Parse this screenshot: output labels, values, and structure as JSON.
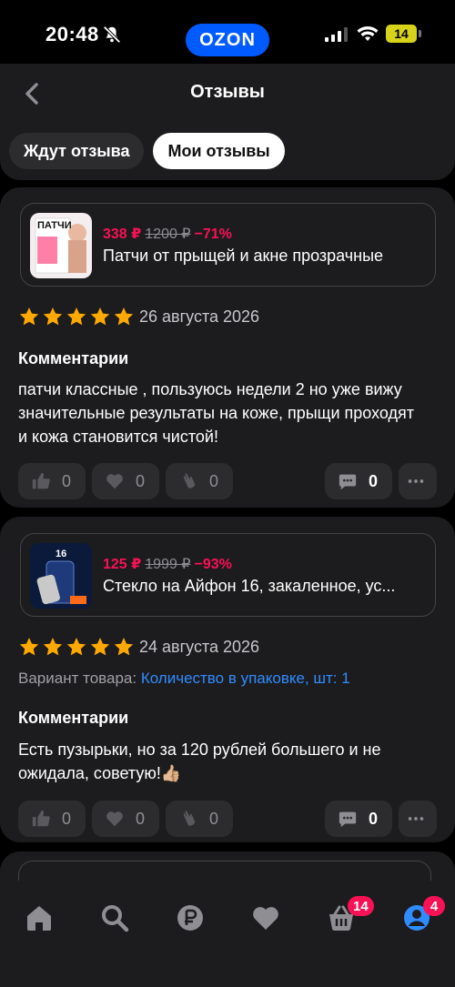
{
  "status": {
    "time": "20:48",
    "battery": "14"
  },
  "brand": "OZON",
  "header": {
    "title": "Отзывы"
  },
  "tabs": [
    {
      "label": "Ждут отзыва"
    },
    {
      "label": "Мои отзывы"
    }
  ],
  "reviews": [
    {
      "price": "338 ₽",
      "old_price": "1200 ₽",
      "discount": "−71%",
      "product_name": "Патчи от прыщей и акне прозрачные",
      "thumb_text": "ПАТЧИ",
      "rating": 5,
      "date": "26 августа 2026",
      "comment_title": "Комментарии",
      "comment": "патчи классные , пользуюсь недели 2 но уже вижу значительные результаты на коже, прыщи проходят и кожа становится чистой!",
      "likes": "0",
      "hearts": "0",
      "claps": "0",
      "replies": "0"
    },
    {
      "price": "125 ₽",
      "old_price": "1999 ₽",
      "discount": "−93%",
      "product_name": "Стекло на Айфон 16, закаленное, ус...",
      "thumb_text": "16",
      "rating": 5,
      "date": "24 августа 2026",
      "variant_label": "Вариант товара:",
      "variant_value": "Количество в упаковке, шт: 1",
      "comment_title": "Комментарии",
      "comment": "Есть пузырьки, но за 120 рублей большего и не ожидала, советую!👍🏼",
      "likes": "0",
      "hearts": "0",
      "claps": "0",
      "replies": "0"
    }
  ],
  "nav": {
    "items": [
      {
        "icon": "home-icon"
      },
      {
        "icon": "search-icon"
      },
      {
        "icon": "ruble-icon"
      },
      {
        "icon": "heart-icon"
      },
      {
        "icon": "basket-icon"
      },
      {
        "icon": "profile-icon"
      }
    ],
    "basket_badge": "14",
    "profile_badge": "4"
  },
  "colors": {
    "accent": "#005bff",
    "price": "#f91155",
    "star": "#ffa800",
    "link": "#2f8cff"
  }
}
